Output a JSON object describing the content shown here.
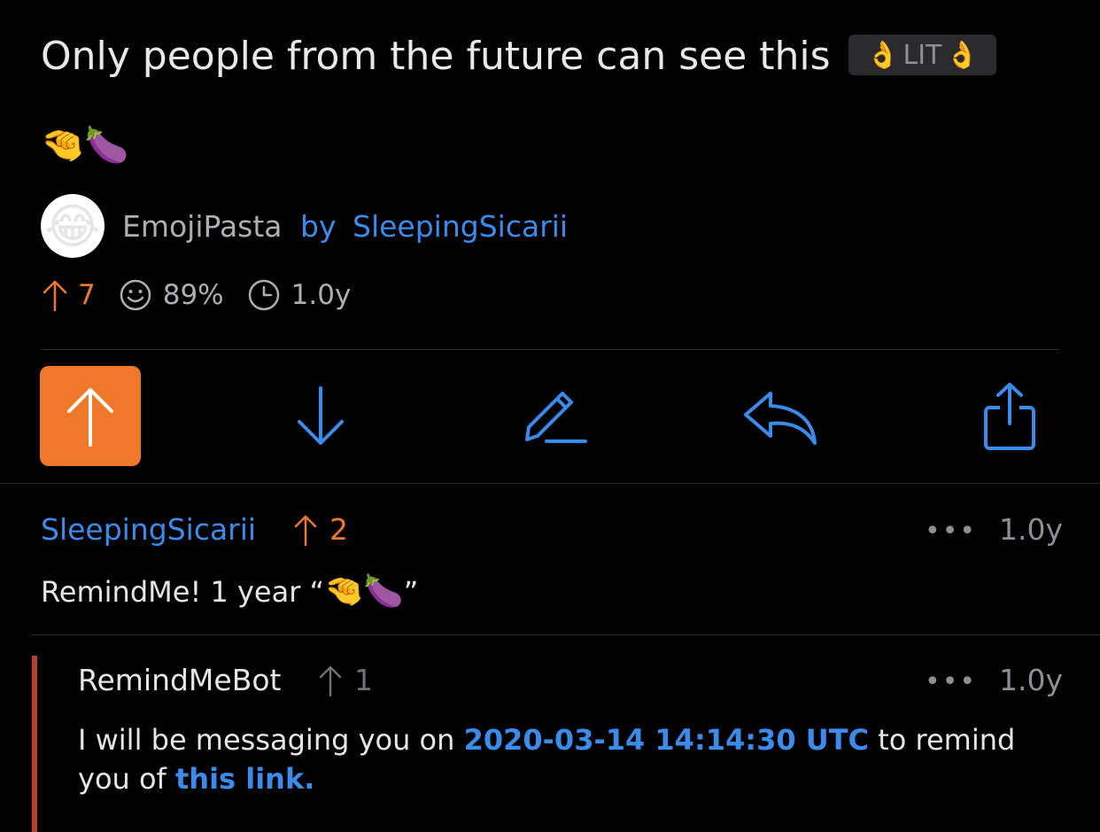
{
  "post": {
    "title": "Only people from the future can see this",
    "flair_left_emoji": "👌",
    "flair_text": "LIT",
    "flair_right_emoji": "👌",
    "body_emoji": "🤏🍆",
    "avatar_emoji": "😂",
    "subreddit": "EmojiPasta",
    "by_label": "by",
    "author": "SleepingSicarii",
    "score": "7",
    "upvote_ratio": "89%",
    "age": "1.0y"
  },
  "actions": {
    "upvote_icon": "arrow-up-icon",
    "downvote_icon": "arrow-down-icon",
    "edit_icon": "pencil-icon",
    "reply_icon": "reply-icon",
    "share_icon": "share-icon"
  },
  "comments": [
    {
      "author": "SleepingSicarii",
      "score": "2",
      "age": "1.0y",
      "text_prefix": "RemindMe! 1 year “",
      "text_emoji": "🤏🍆",
      "text_suffix": "”"
    },
    {
      "author": "RemindMeBot",
      "score": "1",
      "age": "1.0y",
      "text_prefix": "I will be messaging you on ",
      "text_link_date": "2020-03-14 14:14:30 UTC",
      "text_middle": " to remind",
      "text_line2_prefix": "you of ",
      "text_link": "this link."
    }
  ],
  "more_label": "•••",
  "colors": {
    "accent": "#3b8beb",
    "upvote": "#f0782b",
    "background": "#000000",
    "thread_bar": "#b3412f"
  }
}
